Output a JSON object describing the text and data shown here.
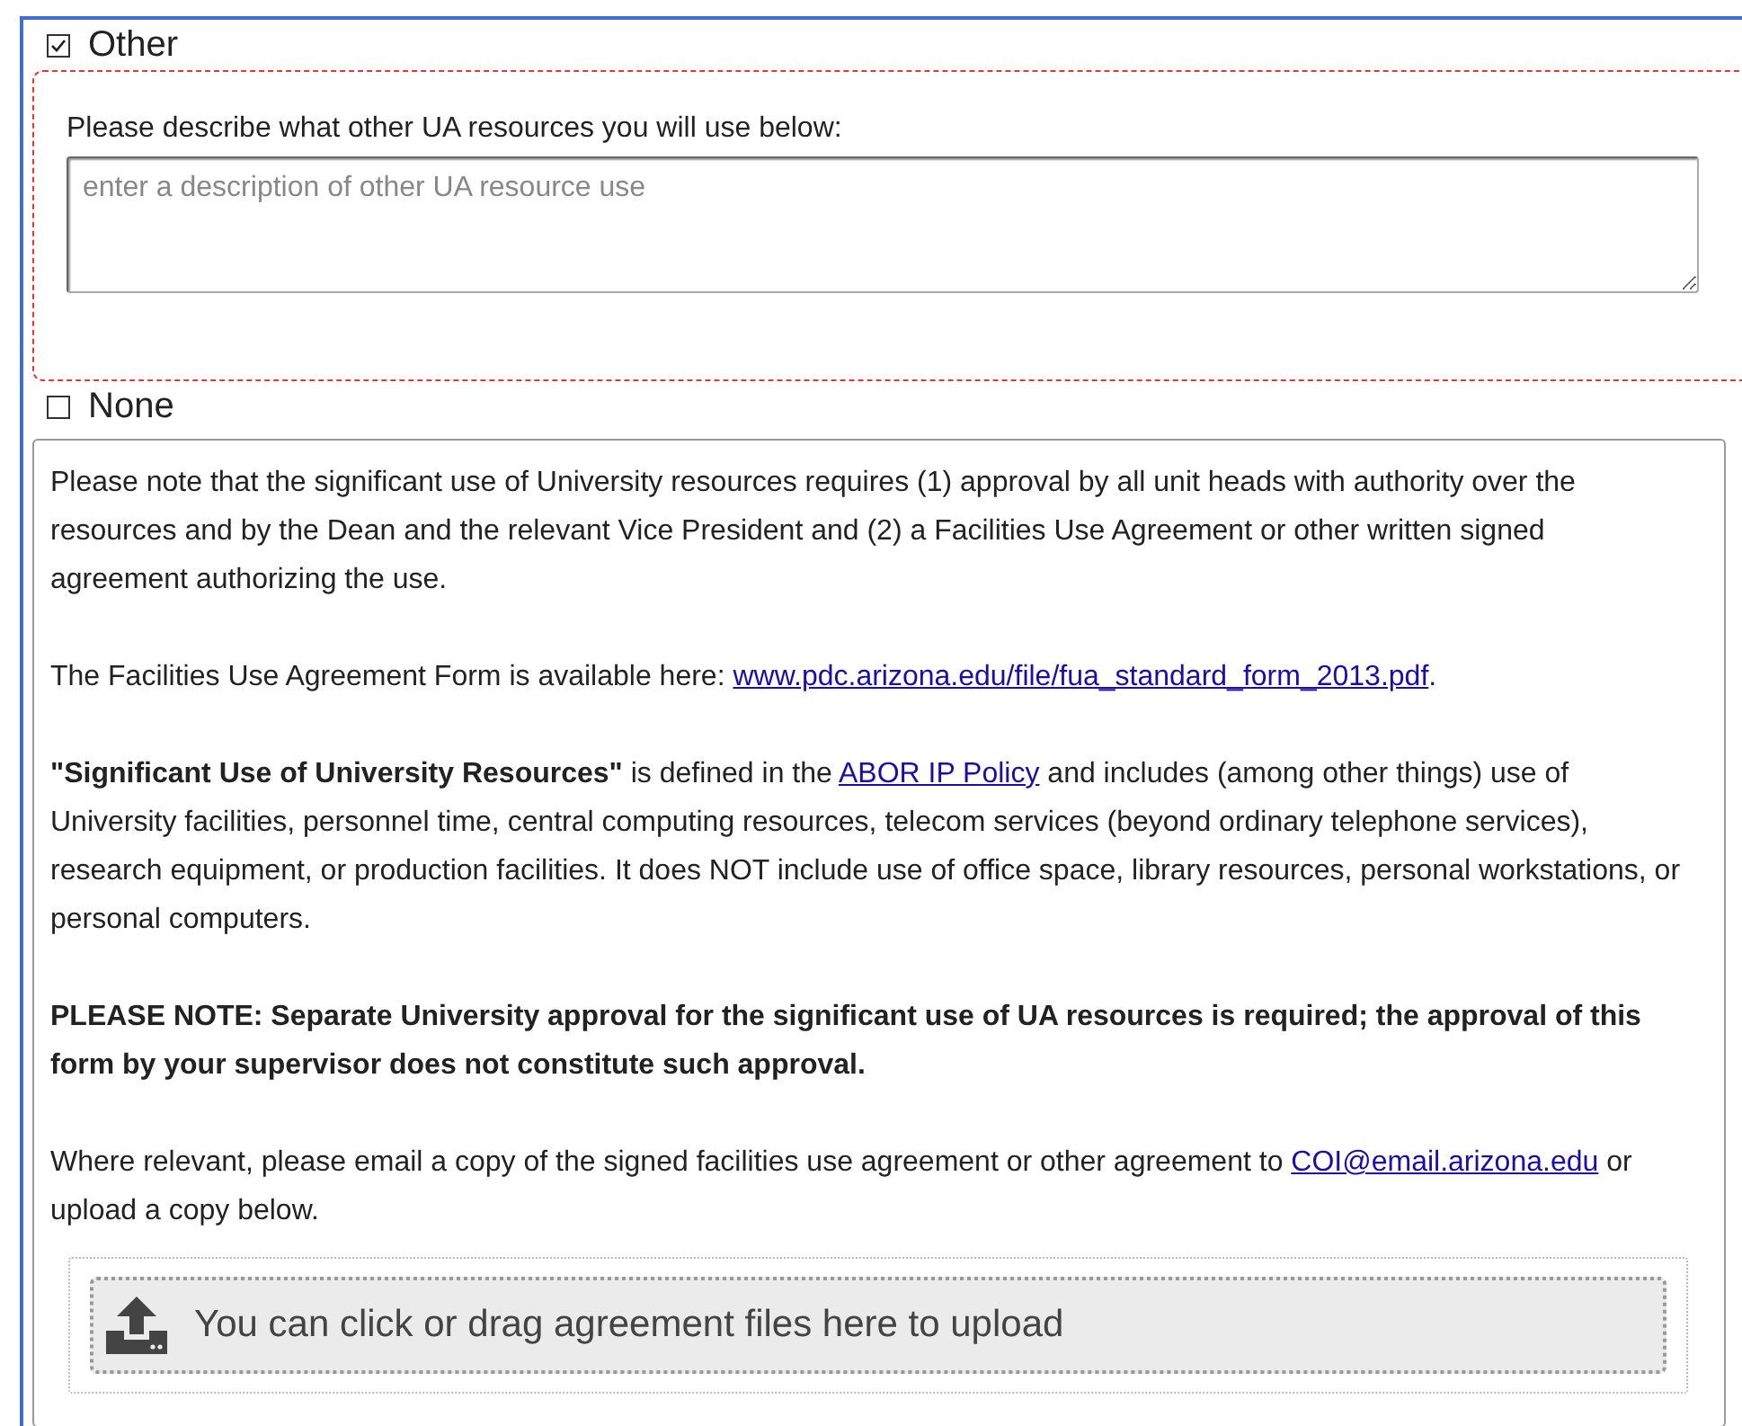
{
  "options": [
    {
      "label": "Other",
      "checked": true
    },
    {
      "label": "None",
      "checked": false
    }
  ],
  "other_details": {
    "label": "Please describe what other UA resources you will use below:",
    "placeholder": "enter a description of other UA resource use"
  },
  "notice": {
    "paragraphs": [
      {
        "bold": false,
        "parts": [
          {
            "kind": "text",
            "text": "Please note that the significant use of University resources requires (1) approval by all unit heads with authority over the resources and by the Dean and the relevant Vice President and (2) a Facilities Use Agreement or other written signed agreement authorizing the use."
          }
        ]
      },
      {
        "bold": false,
        "parts": [
          {
            "kind": "text",
            "text": "The Facilities Use Agreement Form is available here: "
          },
          {
            "kind": "link",
            "text": "www.pdc.arizona.edu/file/fua_standard_form_2013.pdf"
          },
          {
            "kind": "text",
            "text": "."
          }
        ]
      },
      {
        "bold": false,
        "parts": [
          {
            "kind": "text",
            "text": "**\"Significant Use of University Resources\"** is defined in the "
          },
          {
            "kind": "link",
            "text": "ABOR IP Policy"
          },
          {
            "kind": "text",
            "text": " and includes (among other things) use of University facilities, personnel time, central computing resources, telecom services (beyond ordinary telephone services), research equipment, or production facilities. It does NOT include use of office space, library resources, personal workstations, or personal computers."
          }
        ]
      },
      {
        "bold": true,
        "parts": [
          {
            "kind": "text",
            "text": "PLEASE NOTE: Separate University approval for the significant use of UA resources is required; the approval of this form by your supervisor does not constitute such approval."
          }
        ]
      },
      {
        "bold": false,
        "parts": [
          {
            "kind": "text",
            "text": "Where relevant, please email a copy of the signed facilities use agreement or other agreement to "
          },
          {
            "kind": "link",
            "text": "COI@email.arizona.edu"
          },
          {
            "kind": "text",
            "text": " or upload a copy below."
          }
        ]
      }
    ]
  },
  "upload": {
    "label": "You can click or drag agreement files here to upload"
  }
}
